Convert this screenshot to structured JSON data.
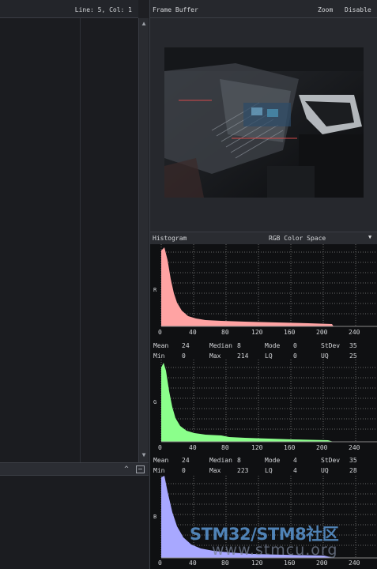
{
  "editor": {
    "cursor_position": "Line: 5, Col: 1"
  },
  "frame_buffer": {
    "title": "Frame Buffer",
    "zoom_label": "Zoom",
    "disable_label": "Disable"
  },
  "histogram": {
    "title": "Histogram",
    "color_space": "RGB Color Space",
    "ticks": [
      "0",
      "40",
      "80",
      "120",
      "160",
      "200",
      "240"
    ],
    "stat_labels": {
      "mean": "Mean",
      "median": "Median",
      "mode": "Mode",
      "stdev": "StDev",
      "min": "Min",
      "max": "Max",
      "lq": "LQ",
      "uq": "UQ"
    },
    "channels": [
      {
        "label": "R",
        "color": "#ff8e8e",
        "stats": {
          "mean": "24",
          "median": "8",
          "mode": "0",
          "stdev": "35",
          "min": "0",
          "max": "214",
          "lq": "0",
          "uq": "25"
        }
      },
      {
        "label": "G",
        "color": "#7fff7f",
        "stats": {
          "mean": "24",
          "median": "8",
          "mode": "4",
          "stdev": "35",
          "min": "0",
          "max": "223",
          "lq": "4",
          "uq": "28"
        }
      },
      {
        "label": "B",
        "color": "#9a9aff"
      }
    ]
  },
  "watermark": {
    "line1": "STM32/STM8社区",
    "line2": "www.stmcu.org"
  }
}
